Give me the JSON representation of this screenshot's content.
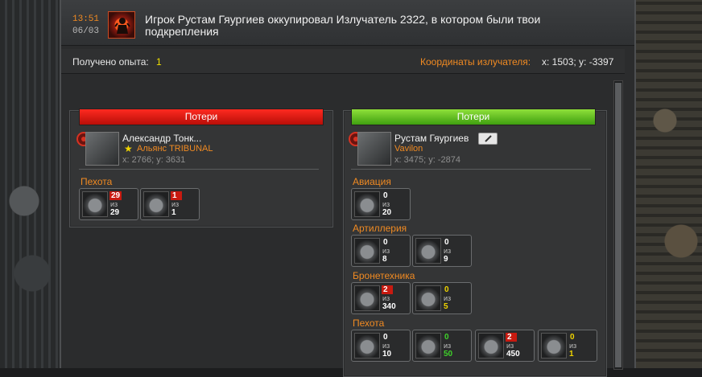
{
  "header": {
    "time": "13:51",
    "date": "06/03",
    "icon": "occupation-alert-icon",
    "message": "Игрок Рустам Гяургиев оккупировал Излучатель 2322, в котором были твои подкрепления"
  },
  "summary": {
    "exp_label": "Получено опыта:",
    "exp_value": "1",
    "coord_label": "Координаты излучателя:",
    "coord_value": "x: 1503; y: -3397"
  },
  "colors": {
    "accent": "#f08a22",
    "loss_red": "#d41a10",
    "loss_green": "#5cc21c",
    "exp_yellow": "#f0e000"
  },
  "left": {
    "header": "Потери",
    "player_name": "Александр Тонк...",
    "alliance": "Альянс TRIBUNAL",
    "coords": "x: 2766; y: 3631",
    "categories": [
      {
        "title": "Пехота",
        "units": [
          {
            "lost": "29",
            "of": "из",
            "total": "29",
            "icon": "infantry-soldier-icon"
          },
          {
            "lost": "1",
            "of": "из",
            "total": "1",
            "icon": "assault-vehicle-icon"
          }
        ]
      }
    ]
  },
  "right": {
    "header": "Потери",
    "player_name": "Рустам Гяургиев",
    "alliance": "Vavilon",
    "coords": "x: 3475; y: -2874",
    "categories": [
      {
        "title": "Авиация",
        "units": [
          {
            "lost": "0",
            "of": "из",
            "total": "20",
            "icon": "aircraft-icon"
          }
        ]
      },
      {
        "title": "Артиллерия",
        "units": [
          {
            "lost": "0",
            "of": "из",
            "total": "8",
            "icon": "artillery-tank-icon"
          },
          {
            "lost": "0",
            "of": "из",
            "total": "9",
            "icon": "artillery-mech-icon"
          }
        ]
      },
      {
        "title": "Бронетехника",
        "units": [
          {
            "lost": "2",
            "of": "из",
            "total": "340",
            "icon": "armored-crawler-icon"
          },
          {
            "lost": "0",
            "of": "из",
            "total": "5",
            "icon": "armored-spider-icon"
          }
        ]
      },
      {
        "title": "Пехота",
        "units": [
          {
            "lost": "0",
            "of": "из",
            "total": "10",
            "icon": "infantry-vehicle-icon"
          },
          {
            "lost": "0",
            "of": "из",
            "total": "50",
            "icon": "rifleman-icon"
          },
          {
            "lost": "2",
            "of": "из",
            "total": "450",
            "icon": "heavy-trooper-icon"
          },
          {
            "lost": "0",
            "of": "из",
            "total": "1",
            "icon": "hero-soldier-icon"
          }
        ]
      }
    ]
  }
}
